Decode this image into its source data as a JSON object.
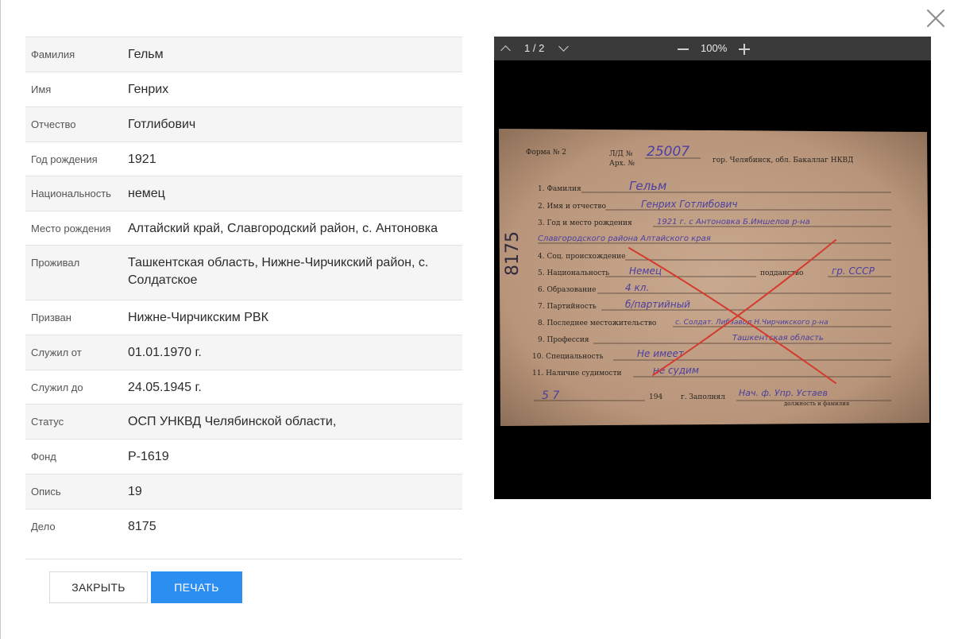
{
  "fields": [
    {
      "label": "Фамилия",
      "value": "Гельм"
    },
    {
      "label": "Имя",
      "value": "Генрих"
    },
    {
      "label": "Отчество",
      "value": "Готлибович"
    },
    {
      "label": "Год рождения",
      "value": "1921"
    },
    {
      "label": "Национальность",
      "value": "немец"
    },
    {
      "label": "Место рождения",
      "value": "Алтайский край, Славгородский район, с. Антоновка"
    },
    {
      "label": "Проживал",
      "value": "Ташкентская область, Нижне-Чирчикский район, с. Солдатское"
    },
    {
      "label": "Призван",
      "value": "Нижне-Чирчикским РВК"
    },
    {
      "label": "Служил от",
      "value": "01.01.1970 г."
    },
    {
      "label": "Служил до",
      "value": "24.05.1945 г."
    },
    {
      "label": "Статус",
      "value": "ОСП УНКВД Челябинской области,"
    },
    {
      "label": "Фонд",
      "value": "Р-1619"
    },
    {
      "label": "Опись",
      "value": "19"
    },
    {
      "label": "Дело",
      "value": "8175"
    }
  ],
  "buttons": {
    "close": "ЗАКРЫТЬ",
    "print": "ПЕЧАТЬ"
  },
  "viewer": {
    "pages": "1 / 2",
    "zoom": "100%"
  },
  "document_card": {
    "form": "Форма № 2",
    "ld": "Л/Д №",
    "ld_number": "25007",
    "arh": "Арх. №",
    "place": "гор. Челябинск, обл. Бакаллаг НКВД",
    "side_number": "8175",
    "lines": [
      {
        "label": "1. Фамилия",
        "hand": "Гельм"
      },
      {
        "label": "2. Имя и отчество",
        "hand": "Генрих Готлибович"
      },
      {
        "label": "3. Год и место рождения",
        "hand": "1921 г. с Антоновка Б.Имшелов р-на"
      },
      {
        "label": "",
        "hand": "Славгородского района Алтайского края"
      },
      {
        "label": "4. Соц. происхождение",
        "hand": ""
      },
      {
        "label": "5. Национальность",
        "hand": "Немец"
      },
      {
        "label": "6. Образование",
        "hand": "4 кл."
      },
      {
        "label": "7. Партийность",
        "hand": "б/партийный"
      },
      {
        "label": "8. Последнее местожительство",
        "hand": "с. Солдат. Либзавод Н.Чирчикского р-на"
      },
      {
        "label": "9. Профессия",
        "hand": "Ташкентская область"
      },
      {
        "label": "10. Специальность",
        "hand": "Не имеет"
      },
      {
        "label": "11. Наличие судимости",
        "hand": "не судим"
      }
    ],
    "poddanstvo": "подданство",
    "poddanstvo_hand": "гр. СССР",
    "date_hand": "5 7",
    "year": "194",
    "zapolnyal": "г. Заполнял",
    "sign_hand": "Нач. ф. Упр. Устаев",
    "sign_caption": "должность и фамилия"
  }
}
